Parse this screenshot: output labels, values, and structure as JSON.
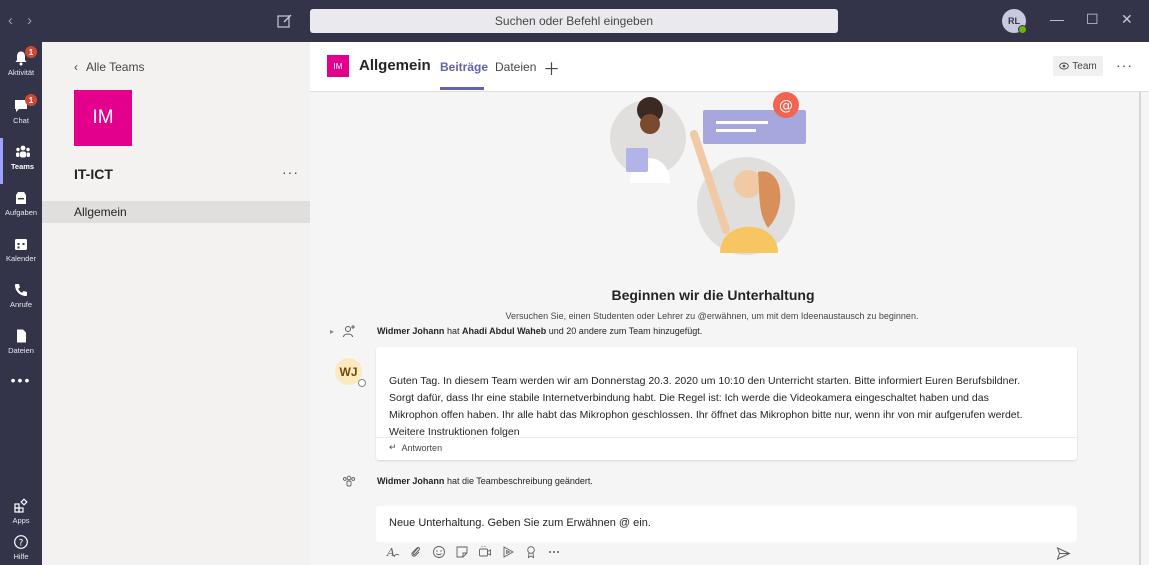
{
  "search": {
    "placeholder": "Suchen oder Befehl eingeben"
  },
  "user": {
    "initials": "RL"
  },
  "appbar": [
    {
      "label": "Aktivität",
      "icon": "bell-icon",
      "badge": "1"
    },
    {
      "label": "Chat",
      "icon": "chat-icon",
      "badge": "1"
    },
    {
      "label": "Teams",
      "icon": "teams-icon",
      "badge": ""
    },
    {
      "label": "Aufgaben",
      "icon": "assignments-icon",
      "badge": ""
    },
    {
      "label": "Kalender",
      "icon": "calendar-icon",
      "badge": ""
    },
    {
      "label": "Anrufe",
      "icon": "phone-icon",
      "badge": ""
    },
    {
      "label": "Dateien",
      "icon": "file-icon",
      "badge": ""
    },
    {
      "label": "Apps",
      "icon": "apps-icon",
      "badge": ""
    },
    {
      "label": "Hilfe",
      "icon": "help-icon",
      "badge": ""
    }
  ],
  "teampanel": {
    "back_label": "Alle Teams",
    "team_tile": "IM",
    "team_name": "IT-ICT",
    "more": "···",
    "channels": [
      "Allgemein"
    ]
  },
  "channel": {
    "tile": "IM",
    "title": "Allgemein",
    "tabs": [
      "Beiträge",
      "Dateien"
    ],
    "team_button": "Team",
    "more": "···"
  },
  "empty_state": {
    "title": "Beginnen wir die Unterhaltung",
    "subtitle": "Versuchen Sie, einen Studenten oder Lehrer zu @erwähnen, um mit dem Ideenaustausch zu beginnen."
  },
  "events": [
    {
      "actor": "Widmer Johann",
      "mid": " hat ",
      "target": "Ahadi Abdul Waheb",
      "rest": " und 20 andere zum Team hinzugefügt."
    },
    {
      "actor": "Widmer Johann",
      "rest": " hat die Teambeschreibung geändert."
    }
  ],
  "post": {
    "avatar": "WJ",
    "lines": [
      "Guten Tag. In diesem Team werden wir am Donnerstag 20.3. 2020 um 10:10 den Unterricht starten. Bitte informiert Euren Berufsbildner.",
      "Sorgt dafür, dass Ihr eine stabile Internetverbindung habt. Die Regel ist: Ich werde die Videokamera eingeschaltet haben und das",
      "Mikrophon offen haben. Ihr alle habt das Mikrophon geschlossen. Ihr öffnet das Mikrophon bitte nur, wenn ihr von mir aufgerufen werdet.",
      "Weitere Instruktionen folgen"
    ],
    "reply_label": "Antworten"
  },
  "composer": {
    "placeholder": "Neue Unterhaltung. Geben Sie zum Erwähnen @ ein."
  },
  "colors": {
    "brand": "#6264a7",
    "rail": "#33344a",
    "tile": "#e3008c",
    "badge": "#cc4a31"
  }
}
